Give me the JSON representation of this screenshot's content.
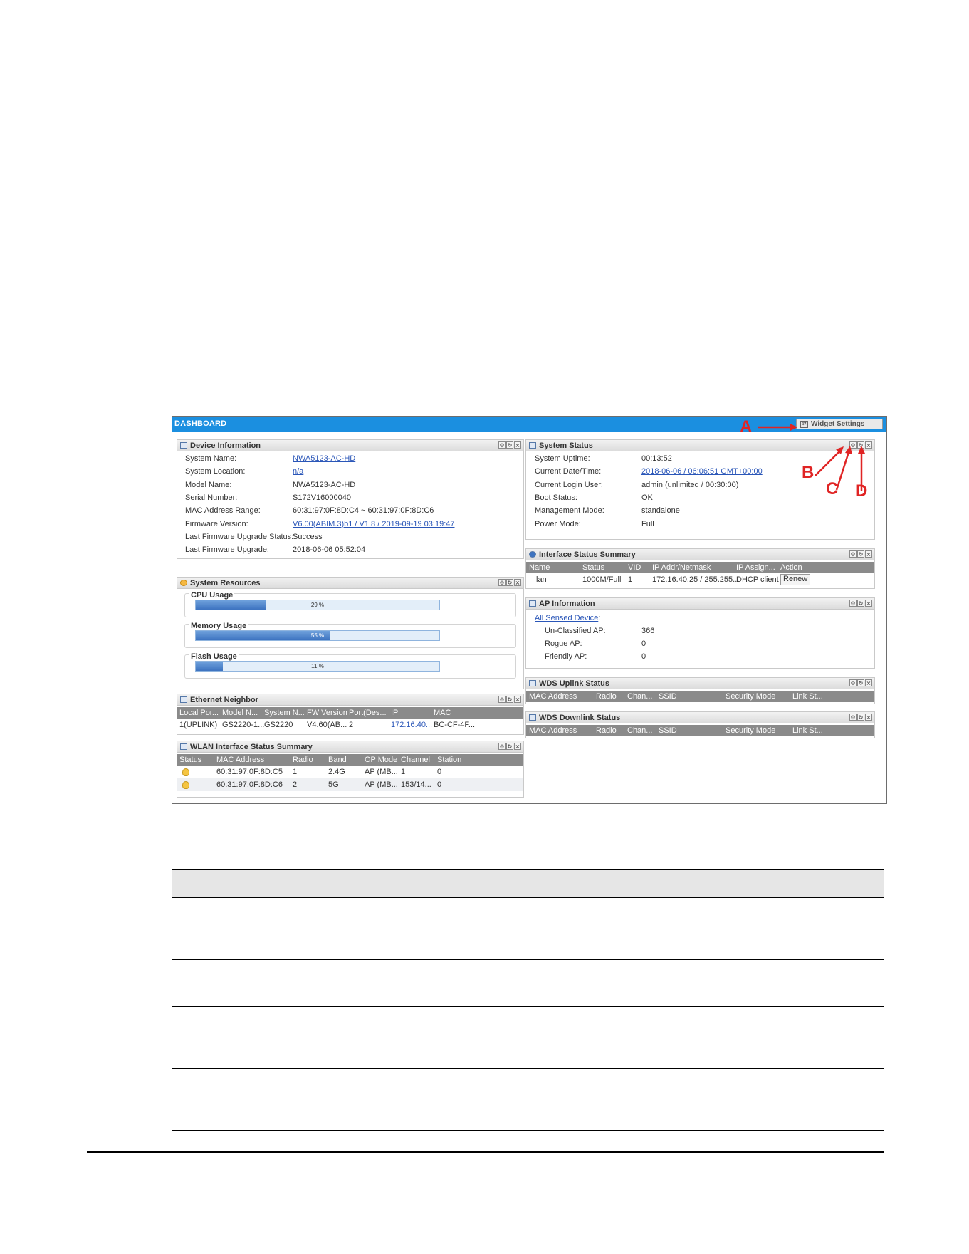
{
  "dashboard": {
    "title": "DASHBOARD",
    "widget_settings_label": "Widget Settings"
  },
  "annotations": {
    "a": "A",
    "b": "B",
    "c": "C",
    "d": "D"
  },
  "device_info": {
    "title": "Device Information",
    "rows": [
      {
        "label": "System Name:",
        "value": "NWA5123-AC-HD",
        "link": true
      },
      {
        "label": "System Location:",
        "value": "n/a",
        "link": true
      },
      {
        "label": "Model Name:",
        "value": "NWA5123-AC-HD",
        "link": false
      },
      {
        "label": "Serial Number:",
        "value": "S172V16000040",
        "link": false
      },
      {
        "label": "MAC Address Range:",
        "value": "60:31:97:0F:8D:C4 ~ 60:31:97:0F:8D:C6",
        "link": false
      },
      {
        "label": "Firmware Version:",
        "value": "V6.00(ABIM.3)b1 / V1.8 / 2019-09-19 03:19:47",
        "link": true
      },
      {
        "label": "Last Firmware Upgrade Status:",
        "value": "Success",
        "link": false
      },
      {
        "label": "Last Firmware Upgrade:",
        "value": "2018-06-06 05:52:04",
        "link": false
      }
    ]
  },
  "system_resources": {
    "title": "System Resources",
    "cpu": {
      "label": "CPU Usage",
      "percent": 29,
      "text": "29 %"
    },
    "memory": {
      "label": "Memory Usage",
      "percent": 55,
      "text": "55 %"
    },
    "flash": {
      "label": "Flash Usage",
      "percent": 11,
      "text": "11 %"
    }
  },
  "ethernet_neighbor": {
    "title": "Ethernet Neighbor",
    "columns": [
      "Local Por...",
      "Model N...",
      "System N...",
      "FW Version",
      "Port(Des...",
      "IP",
      "MAC"
    ],
    "rows": [
      [
        "1(UPLINK)",
        "GS2220-1...",
        "GS2220",
        "V4.60(AB...",
        "2",
        "172.16.40...",
        "BC-CF-4F..."
      ]
    ]
  },
  "wlan_summary": {
    "title": "WLAN Interface Status Summary",
    "columns": [
      "Status",
      "MAC Address",
      "Radio",
      "Band",
      "OP Mode",
      "Channel",
      "Station"
    ],
    "rows": [
      [
        "",
        "60:31:97:0F:8D:C5",
        "1",
        "2.4G",
        "AP (MB...",
        "1",
        "0"
      ],
      [
        "",
        "60:31:97:0F:8D:C6",
        "2",
        "5G",
        "AP (MB...",
        "153/14...",
        "0"
      ]
    ]
  },
  "system_status": {
    "title": "System Status",
    "rows": [
      {
        "label": "System Uptime:",
        "value": "00:13:52",
        "link": false
      },
      {
        "label": "Current Date/Time:",
        "value": "2018-06-06 / 06:06:51 GMT+00:00",
        "link": true
      },
      {
        "label": "Current Login User:",
        "value": "admin (unlimited / 00:30:00)",
        "link": false
      },
      {
        "label": "Boot Status:",
        "value": "OK",
        "link": false
      },
      {
        "label": "Management Mode:",
        "value": "standalone",
        "link": false
      },
      {
        "label": "Power Mode:",
        "value": "Full",
        "link": false
      }
    ]
  },
  "interface_summary": {
    "title": "Interface Status Summary",
    "columns": [
      "Name",
      "Status",
      "VID",
      "IP Addr/Netmask",
      "IP Assign...",
      "Action"
    ],
    "rows": [
      [
        "lan",
        "1000M/Full",
        "1",
        "172.16.40.25 / 255.255...",
        "DHCP client",
        "Renew"
      ]
    ]
  },
  "ap_info": {
    "title": "AP Information",
    "all_sensed": "All Sensed Device",
    "rows": [
      {
        "label": "Un-Classified AP:",
        "value": "366"
      },
      {
        "label": "Rogue AP:",
        "value": "0"
      },
      {
        "label": "Friendly AP:",
        "value": "0"
      }
    ]
  },
  "wds_uplink": {
    "title": "WDS Uplink Status",
    "columns": [
      "MAC Address",
      "Radio",
      "Chan...",
      "SSID",
      "Security Mode",
      "Link St..."
    ]
  },
  "wds_downlink": {
    "title": "WDS Downlink Status",
    "columns": [
      "MAC Address",
      "Radio",
      "Chan...",
      "SSID",
      "Security Mode",
      "Link St..."
    ]
  }
}
